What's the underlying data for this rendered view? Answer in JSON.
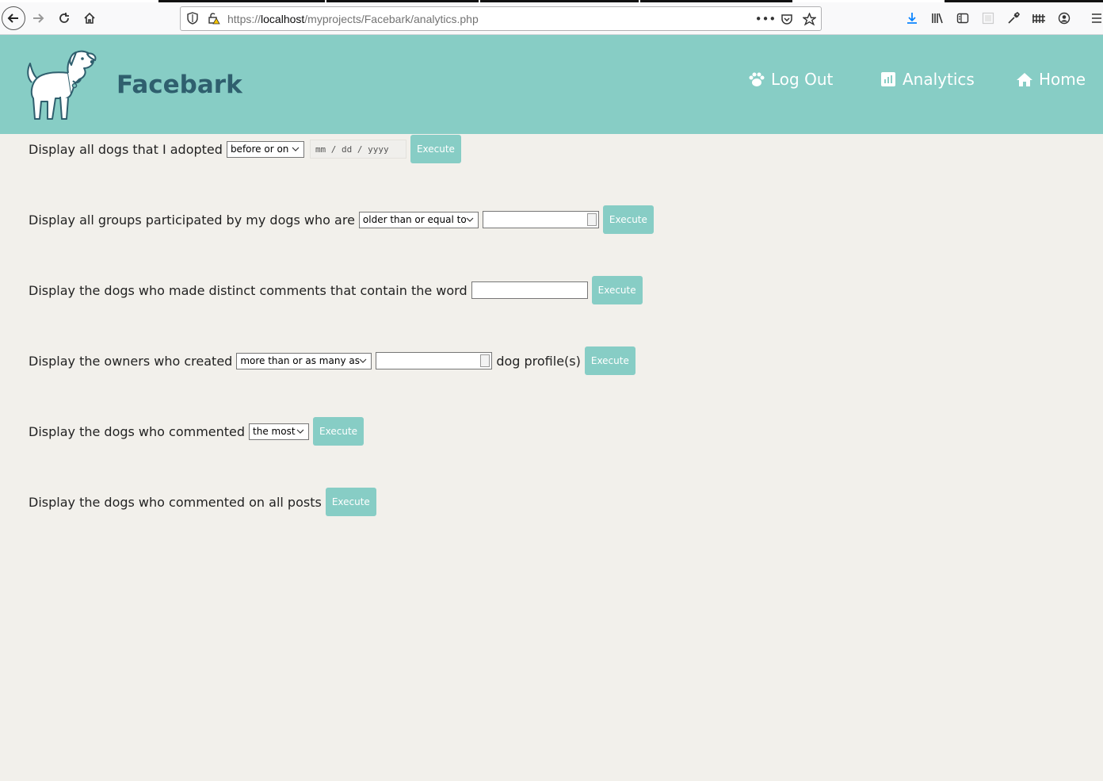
{
  "browser": {
    "url_prefix": "https://",
    "url_host": "localhost",
    "url_path": "/myprojects/Facebark/analytics.php"
  },
  "site": {
    "brand": "Facebark",
    "nav": {
      "logout": "Log Out",
      "analytics": "Analytics",
      "home": "Home"
    },
    "colors": {
      "header_bg": "#87cdc5",
      "brand_text": "#2f5f6e",
      "page_bg": "#f2f0eb"
    }
  },
  "queries": {
    "q1": {
      "text": "Display all dogs that I adopted",
      "select": "before or on",
      "date_placeholder": "mm / dd / yyyy",
      "button": "Execute"
    },
    "q2": {
      "text": "Display all groups participated by my dogs who are",
      "select": "older than or equal to",
      "button": "Execute"
    },
    "q3": {
      "text": "Display the dogs who made distinct comments that contain the word",
      "button": "Execute"
    },
    "q4": {
      "text": "Display the owners who created",
      "select": "more than or as many as",
      "suffix": "dog profile(s)",
      "button": "Execute"
    },
    "q5": {
      "text": "Display the dogs who commented",
      "select": "the most",
      "button": "Execute"
    },
    "q6": {
      "text": "Display the dogs who commented on all posts",
      "button": "Execute"
    }
  }
}
